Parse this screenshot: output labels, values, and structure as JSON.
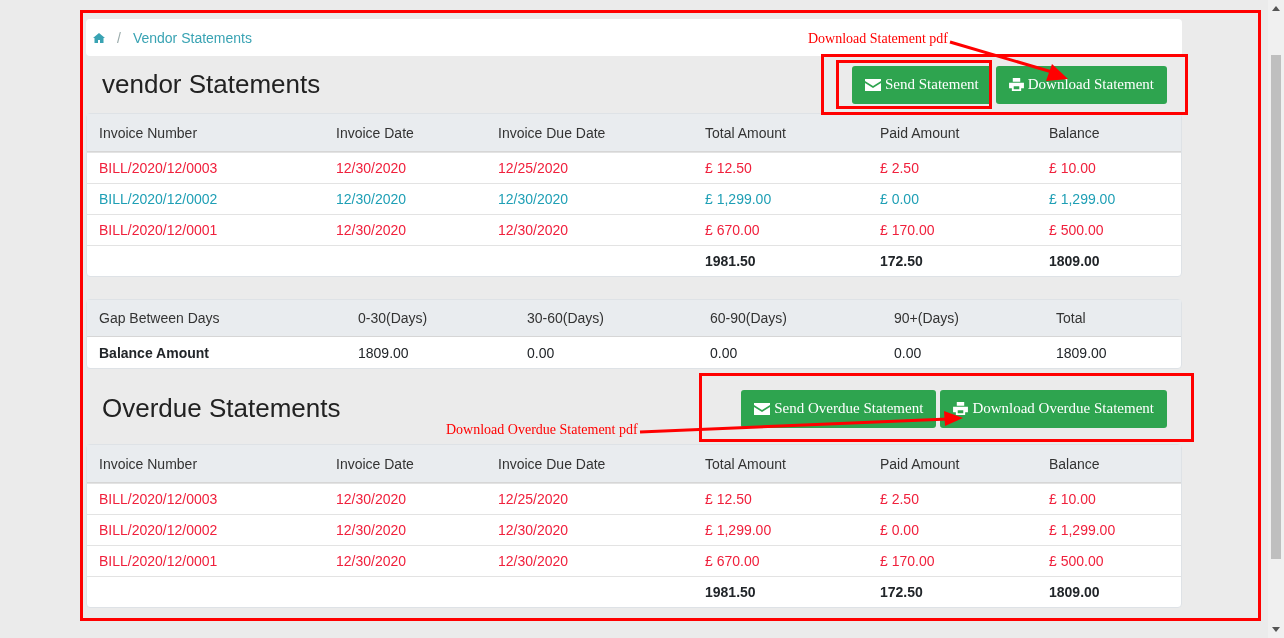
{
  "breadcrumb": {
    "separator": "/",
    "items": [
      "Vendor Statements"
    ]
  },
  "statement": {
    "title": "vendor Statements",
    "buttons": [
      {
        "kind": "send",
        "label": "Send Statement"
      },
      {
        "kind": "download",
        "label": "Download Statement"
      }
    ],
    "table": {
      "columns": [
        "Invoice Number",
        "Invoice Date",
        "Invoice Due Date",
        "Total Amount",
        "Paid Amount",
        "Balance"
      ],
      "rows": [
        {
          "color": "#f0203c",
          "cells": [
            "BILL/2020/12/0003",
            "12/30/2020",
            "12/25/2020",
            "£ 12.50",
            "£ 2.50",
            "£ 10.00"
          ]
        },
        {
          "color": "#1e9fb5",
          "cells": [
            "BILL/2020/12/0002",
            "12/30/2020",
            "12/30/2020",
            "£ 1,299.00",
            "£ 0.00",
            "£ 1,299.00"
          ]
        },
        {
          "color": "#f0203c",
          "cells": [
            "BILL/2020/12/0001",
            "12/30/2020",
            "12/30/2020",
            "£ 670.00",
            "£ 170.00",
            "£ 500.00"
          ]
        }
      ],
      "totals": [
        "1981.50",
        "172.50",
        "1809.00"
      ]
    }
  },
  "aging": {
    "columns": [
      "Gap Between Days",
      "0-30(Days)",
      "30-60(Days)",
      "60-90(Days)",
      "90+(Days)",
      "Total"
    ],
    "row": {
      "label": "Balance Amount",
      "values": [
        "1809.00",
        "0.00",
        "0.00",
        "0.00",
        "1809.00"
      ]
    }
  },
  "overdue": {
    "title": "Overdue Statements",
    "buttons": [
      {
        "kind": "send",
        "label": "Send Overdue Statement"
      },
      {
        "kind": "download",
        "label": "Download Overdue Statement"
      }
    ],
    "table": {
      "columns": [
        "Invoice Number",
        "Invoice Date",
        "Invoice Due Date",
        "Total Amount",
        "Paid Amount",
        "Balance"
      ],
      "rows": [
        {
          "color": "#f0203c",
          "cells": [
            "BILL/2020/12/0003",
            "12/30/2020",
            "12/25/2020",
            "£ 12.50",
            "£ 2.50",
            "£ 10.00"
          ]
        },
        {
          "color": "#f0203c",
          "cells": [
            "BILL/2020/12/0002",
            "12/30/2020",
            "12/30/2020",
            "£ 1,299.00",
            "£ 0.00",
            "£ 1,299.00"
          ]
        },
        {
          "color": "#f0203c",
          "cells": [
            "BILL/2020/12/0001",
            "12/30/2020",
            "12/30/2020",
            "£ 670.00",
            "£ 170.00",
            "£ 500.00"
          ]
        }
      ],
      "totals": [
        "1981.50",
        "172.50",
        "1809.00"
      ]
    }
  },
  "annotations": [
    {
      "text": "Download Statement pdf"
    },
    {
      "text": "Download Overdue Statement pdf"
    }
  ]
}
